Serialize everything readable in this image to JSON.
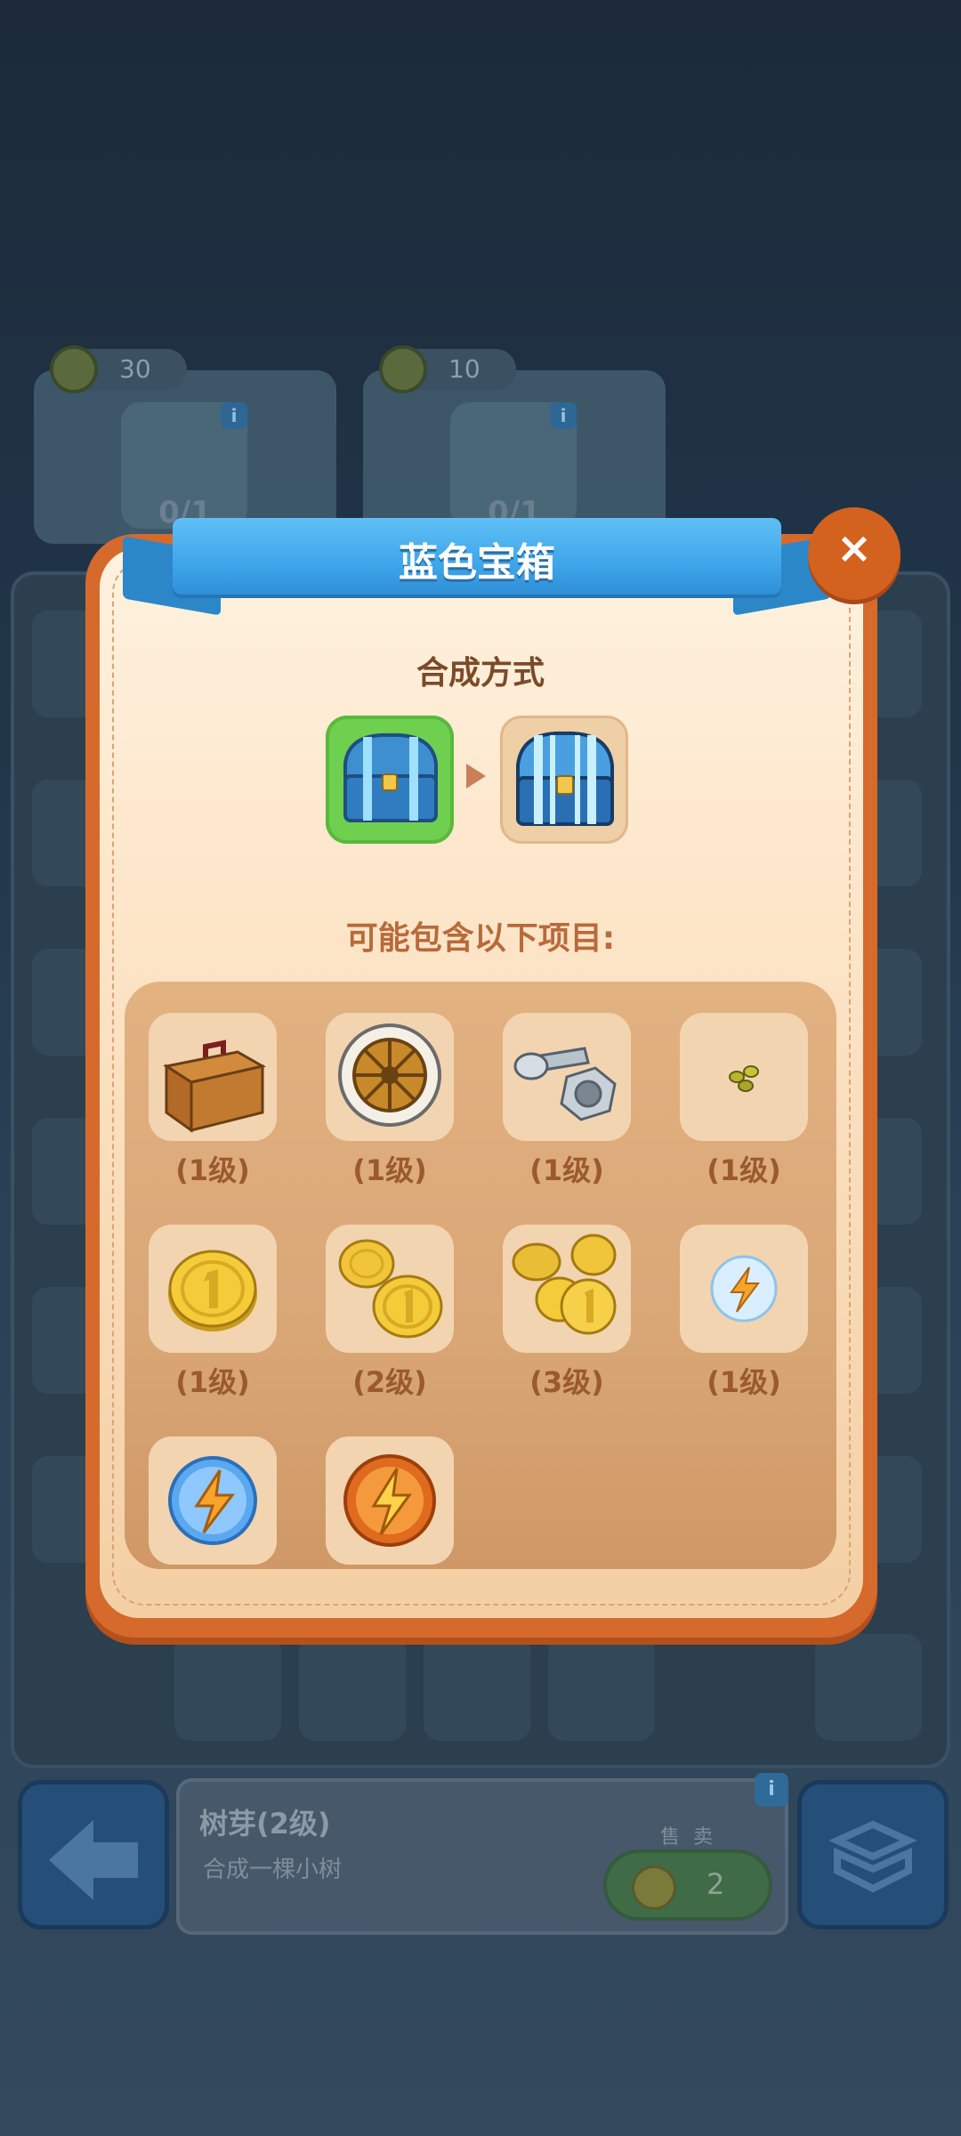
{
  "background": {
    "quests": [
      {
        "reward": "30",
        "progress": "0/1"
      },
      {
        "reward": "10",
        "progress": "0/1"
      }
    ],
    "selected_item": {
      "name": "树芽(2级)",
      "description": "合成一棵小树",
      "sell_label": "售 卖",
      "sell_price": "2"
    }
  },
  "modal": {
    "title": "蓝色宝箱",
    "close_icon": "×",
    "recipe_title": "合成方式",
    "contains_title": "可能包含以下项目:",
    "items": [
      {
        "icon": "toolbox-icon",
        "level": "(1级)"
      },
      {
        "icon": "wheel-icon",
        "level": "(1级)"
      },
      {
        "icon": "nut-bolt-icon",
        "level": "(1级)"
      },
      {
        "icon": "seeds-icon",
        "level": "(1级)"
      },
      {
        "icon": "coin-icon",
        "level": "(1级)"
      },
      {
        "icon": "coins-icon",
        "level": "(2级)"
      },
      {
        "icon": "coin-pile-icon",
        "level": "(3级)"
      },
      {
        "icon": "energy-orb-small-icon",
        "level": "(1级)"
      },
      {
        "icon": "energy-orb-blue-icon",
        "level": ""
      },
      {
        "icon": "energy-orb-orange-icon",
        "level": ""
      }
    ]
  },
  "colors": {
    "modal_border": "#d56a2c",
    "ribbon_blue": "#3fa6ea",
    "item_label": "#9a5a2e",
    "recipe_source_bg": "#6fd050"
  }
}
